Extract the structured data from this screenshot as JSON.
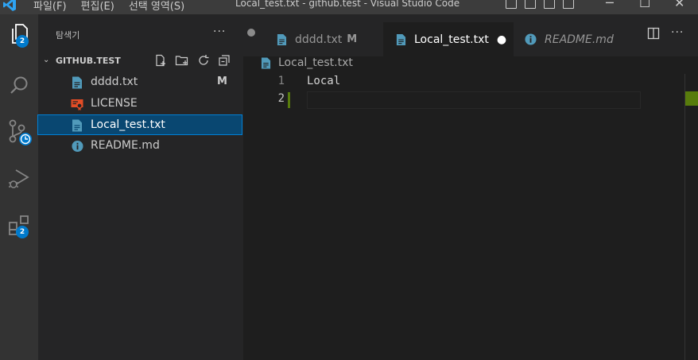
{
  "titlebar": {
    "menu": [
      "파일(F)",
      "편집(E)",
      "선택 영역(S)"
    ],
    "window_title": "Local_test.txt - github.test - Visual Studio Code"
  },
  "activity_bar": {
    "explorer_badge": "2",
    "extensions_badge": "2"
  },
  "sidebar": {
    "title": "탐색기",
    "more_label": "···",
    "section_name": "GITHUB.TEST",
    "files": [
      {
        "name": "dddd.txt",
        "status": "M",
        "icon": "file-text-icon"
      },
      {
        "name": "LICENSE",
        "status": "",
        "icon": "certificate-icon"
      },
      {
        "name": "Local_test.txt",
        "status": "",
        "icon": "file-text-icon"
      },
      {
        "name": "README.md",
        "status": "",
        "icon": "info-icon"
      }
    ]
  },
  "tabs": [
    {
      "name": "dddd.txt",
      "status": "M"
    },
    {
      "name": "Local_test.txt",
      "status": "●"
    },
    {
      "name": "README.md",
      "status": ""
    }
  ],
  "breadcrumb": {
    "file": "Local_test.txt"
  },
  "editor": {
    "lines": [
      {
        "number": "1",
        "text": "Local"
      },
      {
        "number": "2",
        "text": ""
      }
    ]
  },
  "colors": {
    "accent": "#007acc",
    "file_icon": "#519aba",
    "license_icon": "#e44d26",
    "git_added": "#587c0c"
  }
}
